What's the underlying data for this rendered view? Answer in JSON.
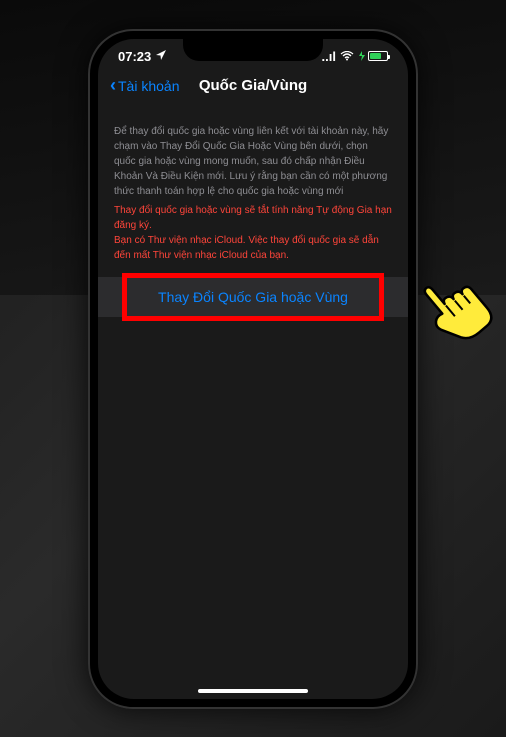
{
  "status_bar": {
    "time": "07:23",
    "signal_bars": "..ıl",
    "battery_charging": true
  },
  "nav": {
    "back_label": "Tài khoản",
    "title": "Quốc Gia/Vùng"
  },
  "content": {
    "info_text": "Để thay đổi quốc gia hoặc vùng liên kết với tài khoản này, hãy chạm vào Thay Đổi Quốc Gia Hoặc Vùng bên dưới, chọn quốc gia hoặc vùng mong muốn, sau đó chấp nhận Điều Khoản Và Điều Kiện mới. Lưu ý rằng bạn cần có một phương thức thanh toán hợp lệ cho quốc gia hoặc vùng mới",
    "warning_text_1": "Thay đổi quốc gia hoặc vùng sẽ tắt tính năng Tự động Gia hạn đăng ký.",
    "warning_text_2": "Bạn có Thư viện nhạc iCloud. Việc thay đổi quốc gia sẽ dẫn đến mất Thư viện nhạc iCloud của bạn."
  },
  "action": {
    "change_button_label": "Thay Đổi Quốc Gia hoặc Vùng"
  }
}
